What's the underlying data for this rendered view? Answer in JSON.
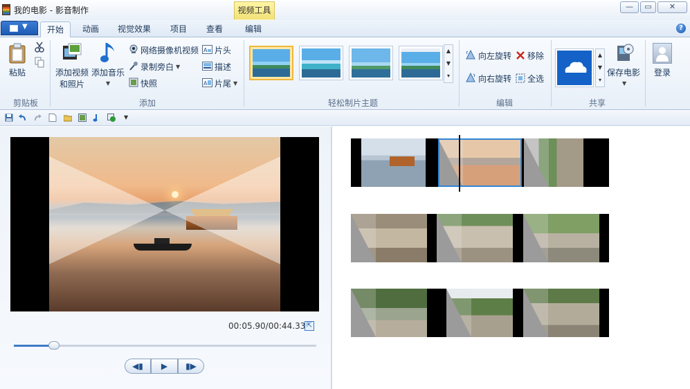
{
  "window": {
    "title": "我的电影 - 影音制作",
    "context_tab": "视频工具",
    "buttons": {
      "minimize": "—",
      "maximize": "▭",
      "close": "✕"
    }
  },
  "tabs": [
    "开始",
    "动画",
    "视觉效果",
    "项目",
    "查看",
    "编辑"
  ],
  "ribbon": {
    "clipboard": {
      "paste": "粘贴",
      "group": "剪贴板"
    },
    "add": {
      "add_video_line1": "添加视频",
      "add_video_line2": "和照片",
      "add_music": "添加音乐",
      "webcam": "网络摄像机视频",
      "narration": "录制旁白",
      "snapshot": "快照",
      "title": "片头",
      "caption": "描述",
      "credits": "片尾",
      "group": "添加"
    },
    "themes": {
      "group": "轻松制片主题"
    },
    "editing": {
      "rotate_left": "向左旋转",
      "rotate_right": "向右旋转",
      "remove": "移除",
      "select_all": "全选",
      "group": "编辑"
    },
    "share": {
      "save_movie": "保存电影",
      "group": "共享"
    },
    "signin": {
      "label": "登录"
    }
  },
  "preview": {
    "timecode": "00:05.90/00:44.33",
    "progress": 0.133
  },
  "playback": {
    "prev": "◀▮",
    "play": "▶",
    "next": "▮▶"
  },
  "colors": {
    "accent": "#3d7bc6",
    "context_tab": "#f2e076",
    "selection": "#2f86d6"
  }
}
